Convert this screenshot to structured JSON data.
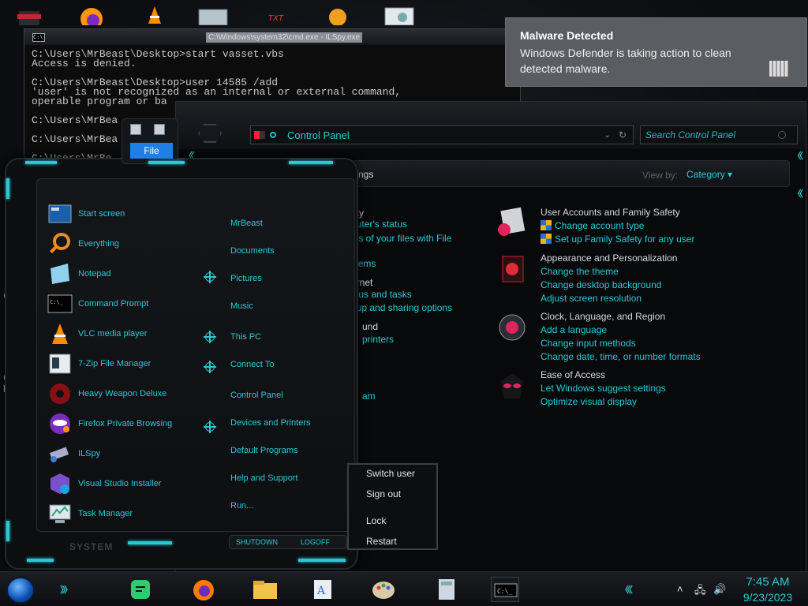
{
  "cmd": {
    "title": "C:\\Windows\\system32\\cmd.exe - ILSpy.exe",
    "lines": [
      "C:\\Users\\MrBeast\\Desktop>start vasset.vbs",
      "Access is denied.",
      "",
      "C:\\Users\\MrBeast\\Desktop>user 14585 /add",
      "'user' is not recognized as an internal or external command,",
      "operable program or ba",
      "",
      "C:\\Users\\MrBea",
      "",
      "C:\\Users\\MrBea",
      "",
      "C:\\Users\\MrBe"
    ]
  },
  "toast": {
    "title": "Malware Detected",
    "body": "Windows Defender is taking action to clean detected malware."
  },
  "control_panel": {
    "address": "Control Panel",
    "search_placeholder": "Search Control Panel",
    "heading_fragment": "ngs",
    "view_by_label": "View by:",
    "view_by_value": "Category ▾",
    "left_fragments": [
      {
        "text": "rity",
        "kind": "hdr"
      },
      {
        "text": "puter's status",
        "kind": "lnk"
      },
      {
        "text": "ies of your files with File",
        "kind": "lnk"
      },
      {
        "text": "lems",
        "kind": "lnk"
      },
      {
        "text": "ernet",
        "kind": "hdr"
      },
      {
        "text": "tus and tasks",
        "kind": "lnk"
      },
      {
        "text": "oup and sharing options",
        "kind": "lnk"
      },
      {
        "text": "und",
        "kind": "hdr"
      },
      {
        "text": "printers",
        "kind": "lnk"
      },
      {
        "text": "am",
        "kind": "lnk"
      }
    ],
    "categories": [
      {
        "title": "User Accounts and Family Safety",
        "links": [
          "Change account type",
          "Set up Family Safety for any user"
        ],
        "shielded": true,
        "icon": "user-accounts-icon"
      },
      {
        "title": "Appearance and Personalization",
        "links": [
          "Change the theme",
          "Change desktop background",
          "Adjust screen resolution"
        ],
        "shielded": false,
        "icon": "appearance-icon"
      },
      {
        "title": "Clock, Language, and Region",
        "links": [
          "Add a language",
          "Change input methods",
          "Change date, time, or number formats"
        ],
        "shielded": false,
        "icon": "clock-language-icon"
      },
      {
        "title": "Ease of Access",
        "links": [
          "Let Windows suggest settings",
          "Optimize visual display"
        ],
        "shielded": false,
        "icon": "ease-of-access-icon"
      }
    ]
  },
  "start_menu": {
    "file_button": "File",
    "apps": [
      {
        "label": "Start screen",
        "icon": "start-screen-icon"
      },
      {
        "label": "Everything",
        "icon": "everything-search-icon"
      },
      {
        "label": "Notepad",
        "icon": "notepad-icon"
      },
      {
        "label": "Command Prompt",
        "icon": "command-prompt-icon"
      },
      {
        "label": "VLC media player",
        "icon": "vlc-cone-icon"
      },
      {
        "label": "7-Zip File Manager",
        "icon": "7zip-icon"
      },
      {
        "label": "Heavy Weapon Deluxe",
        "icon": "heavy-weapon-icon"
      },
      {
        "label": "Firefox Private Browsing",
        "icon": "firefox-private-icon"
      },
      {
        "label": "ILSpy",
        "icon": "ilspy-icon"
      },
      {
        "label": "Visual Studio Installer",
        "icon": "visual-studio-installer-icon"
      },
      {
        "label": "Task Manager",
        "icon": "task-manager-icon"
      }
    ],
    "places": [
      "MrBeast",
      "Documents",
      "Pictures",
      "Music",
      "This PC",
      "Connect To",
      "Control Panel",
      "Devices and Printers",
      "Default Programs",
      "Help and Support",
      "Run..."
    ],
    "system_label": "SYSTEM",
    "shutdown_label": "SHUTDOWN",
    "logoff_label": "LOGOFF"
  },
  "power_menu": {
    "items": [
      "Switch user",
      "Sign out",
      "Lock",
      "Restart"
    ]
  },
  "taskbar": {
    "time": "7:45 AM",
    "date": "9/23/2023",
    "accent": "#29c9d4"
  }
}
